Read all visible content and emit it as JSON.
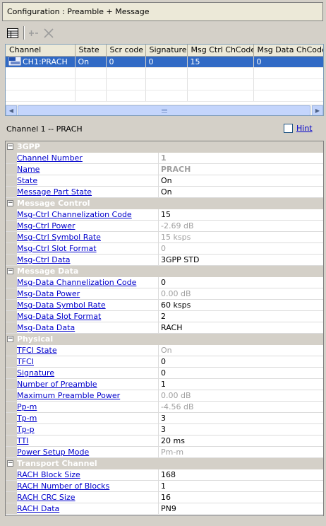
{
  "window": {
    "title": "Configuration : Preamble + Message"
  },
  "toolbar": {
    "buttons": [
      {
        "name": "table-icon",
        "enabled": true
      },
      {
        "name": "add-icon",
        "enabled": false
      },
      {
        "name": "delete-icon",
        "enabled": false
      }
    ]
  },
  "grid": {
    "columns": [
      "Channel",
      "State",
      "Scr code",
      "Signature",
      "Msg Ctrl ChCode",
      "Msg Data ChCode"
    ],
    "rows": [
      {
        "channel": "CH1:PRACH",
        "state": "On",
        "scr_code": "0",
        "signature": "0",
        "msg_ctrl_chcode": "15",
        "msg_data_chcode": "0",
        "selected": true
      }
    ]
  },
  "details": {
    "title": "Channel 1 -- PRACH",
    "hint_label": "Hint",
    "hint_checked": false
  },
  "categories": [
    {
      "name": "3GPP",
      "props": [
        {
          "name": "Channel Number",
          "value": "1",
          "style": "bold"
        },
        {
          "name": "Name",
          "value": "PRACH",
          "style": "bold"
        },
        {
          "name": "State",
          "value": "On",
          "style": "normal"
        },
        {
          "name": "Message Part State",
          "value": "On",
          "style": "normal"
        }
      ]
    },
    {
      "name": "Message Control",
      "props": [
        {
          "name": "Msg-Ctrl Channelization Code",
          "value": "15",
          "style": "normal"
        },
        {
          "name": "Msg-Ctrl Power",
          "value": "-2.69 dB",
          "style": "disabled"
        },
        {
          "name": "Msg-Ctrl Symbol Rate",
          "value": "15 ksps",
          "style": "disabled"
        },
        {
          "name": "Msg-Ctrl Slot Format",
          "value": "0",
          "style": "disabled"
        },
        {
          "name": "Msg-Ctrl Data",
          "value": "3GPP STD",
          "style": "normal"
        }
      ]
    },
    {
      "name": "Message Data",
      "props": [
        {
          "name": "Msg-Data Channelization Code",
          "value": "0",
          "style": "normal"
        },
        {
          "name": "Msg-Data Power",
          "value": "0.00 dB",
          "style": "disabled"
        },
        {
          "name": "Msg-Data Symbol Rate",
          "value": "60 ksps",
          "style": "normal"
        },
        {
          "name": "Msg-Data Slot Format",
          "value": "2",
          "style": "normal"
        },
        {
          "name": "Msg-Data Data",
          "value": "RACH",
          "style": "normal"
        }
      ]
    },
    {
      "name": "Physical",
      "props": [
        {
          "name": "TFCI State",
          "value": "On",
          "style": "disabled"
        },
        {
          "name": "TFCI",
          "value": "0",
          "style": "normal"
        },
        {
          "name": "Signature",
          "value": "0",
          "style": "normal"
        },
        {
          "name": "Number of Preamble",
          "value": "1",
          "style": "normal"
        },
        {
          "name": "Maximum Preamble Power",
          "value": "0.00 dB",
          "style": "disabled"
        },
        {
          "name": "Pp-m",
          "value": "-4.56 dB",
          "style": "disabled"
        },
        {
          "name": "Tp-m",
          "value": "3",
          "style": "normal"
        },
        {
          "name": "Tp-p",
          "value": "3",
          "style": "normal"
        },
        {
          "name": "TTI",
          "value": "20 ms",
          "style": "normal"
        },
        {
          "name": "Power Setup Mode",
          "value": "Pm-m",
          "style": "disabled"
        }
      ]
    },
    {
      "name": "Transport Channel",
      "props": [
        {
          "name": "RACH Block Size",
          "value": "168",
          "style": "normal"
        },
        {
          "name": "RACH Number of Blocks",
          "value": "1",
          "style": "normal"
        },
        {
          "name": "RACH CRC Size",
          "value": "16",
          "style": "normal"
        },
        {
          "name": "RACH Data",
          "value": "PN9",
          "style": "normal"
        }
      ]
    }
  ]
}
